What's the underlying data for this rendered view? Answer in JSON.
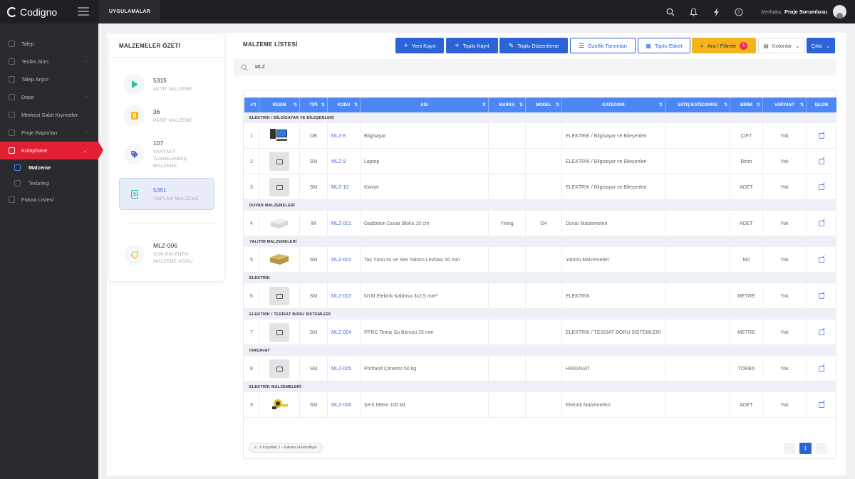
{
  "app": {
    "brand": "Codigno",
    "top_menu": "UYGULAMALAR",
    "greeting": "Merhaba,",
    "user": "Proje Sorumlusu"
  },
  "sidebar": {
    "items": [
      {
        "label": "Talep",
        "has_chevron": false
      },
      {
        "label": "Teslim Alım",
        "has_chevron": true
      },
      {
        "label": "Talep Arşivi",
        "has_chevron": false
      },
      {
        "label": "Depo",
        "has_chevron": true
      },
      {
        "label": "Merkezi Sabit Kıymetler",
        "has_chevron": false
      },
      {
        "label": "Proje Raporları",
        "has_chevron": true
      },
      {
        "label": "Kütüphane",
        "has_chevron": true,
        "active": true
      }
    ],
    "sub_items": [
      {
        "label": "Malzeme",
        "active": true
      },
      {
        "label": "Tedarikçi"
      }
    ],
    "extra": [
      {
        "label": "Fatura Listesi"
      }
    ]
  },
  "summary": {
    "title": "MALZEMELER ÖZETİ",
    "items": [
      {
        "value": "5315",
        "label": "AKTİF MALZEME",
        "icon": "play-icon",
        "color": "#2fc1a7"
      },
      {
        "value": "36",
        "label": "PASİF MALZEME",
        "icon": "pause-icon",
        "color": "#f5b31c"
      },
      {
        "value": "107",
        "label": "VARYANT TANIMLANMIŞ MALZEME",
        "icon": "tag-icon",
        "color": "#5a6fd8"
      },
      {
        "value": "5351",
        "label": "TOPLAM MALZEME",
        "icon": "document-icon",
        "color": "#2fc1a7"
      },
      {
        "value": "MLZ-006",
        "label": "SON EKLENEN MALZEME KODU",
        "icon": "label-icon",
        "color": "#f5b31c"
      }
    ]
  },
  "list": {
    "title": "MALZEME LİSTESİ",
    "buttons": {
      "new": "Yeni Kayıt",
      "bulk": "Toplu Kayıt",
      "bulk_edit": "Toplu Düzenleme",
      "props": "Özellik Tanımları",
      "bulk_label": "Toplu Etiket",
      "filter": "Ara / Filtrele",
      "filter_count": "1",
      "columns": "Kolonlar",
      "output": "Çıktı"
    },
    "search_value": "MLZ",
    "columns": [
      "#",
      "RESİM",
      "TİPİ",
      "KODU",
      "ADI",
      "MARKA",
      "MODEL",
      "KATEGORİ",
      "SATIŞ KATEGORİSİ",
      "BİRİM",
      "VARYANT",
      "İŞLEM"
    ],
    "groups": [
      "ELEKTRİK / BİLGİSAYAR VE BİLEŞENLERİ",
      "DUVAR MALZEMELERİ",
      "YALITIM MALZEMELERİ",
      "ELEKTRİK",
      "ELEKTRİK / TESİSAT BORU SİSTEMLERİ",
      "HIRDAVAT",
      "ELEKTRİK MALZEMELERİ"
    ],
    "rows": [
      {
        "no": "1",
        "type": "DB",
        "code": "MLZ-8",
        "name": "Bilgisayar",
        "brand": "",
        "model": "",
        "category": "ELEKTRİK / Bilgisayar ve Bileşenleri",
        "unit": "ÇİFT",
        "variant": "Yok",
        "image": "computer"
      },
      {
        "no": "2",
        "type": "SM",
        "code": "MLZ-9",
        "name": "Laptop",
        "brand": "",
        "model": "",
        "category": "ELEKTRİK / Bilgisayar ve Bileşenleri",
        "unit": "Birim",
        "variant": "Yok",
        "image": "placeholder"
      },
      {
        "no": "3",
        "type": "SM",
        "code": "MLZ-10",
        "name": "Klavye",
        "brand": "",
        "model": "",
        "category": "ELEKTRİK / Bilgisayar ve Bileşenleri",
        "unit": "ADET",
        "variant": "Yok",
        "image": "placeholder"
      },
      {
        "no": "4",
        "type": "IM",
        "code": "MLZ-001",
        "name": "Gazbeton Duvar Bloku 10 cm",
        "brand": "Ytong",
        "model": "G4",
        "category": "Duvar Malzemeleri",
        "unit": "ADET",
        "variant": "Yok",
        "image": "block"
      },
      {
        "no": "5",
        "type": "SM",
        "code": "MLZ-002",
        "name": "Taş Yünü Isı ve Ses Yalıtım Levhası 50 mm",
        "brand": "",
        "model": "",
        "category": "Yalıtım Malzemeleri",
        "unit": "M2",
        "variant": "Yok",
        "image": "insulation"
      },
      {
        "no": "6",
        "type": "SM",
        "code": "MLZ-003",
        "name": "NYM Elektrik Kablosu 3x2,5 mm²",
        "brand": "",
        "model": "",
        "category": "ELEKTRİK",
        "unit": "METRE",
        "variant": "Yok",
        "image": "placeholder"
      },
      {
        "no": "7",
        "type": "SM",
        "code": "MLZ-004",
        "name": "PPRC Temiz Su Borusu 25 mm",
        "brand": "",
        "model": "",
        "category": "ELEKTRİK / TESİSAT BORU SİSTEMLERİ",
        "unit": "METRE",
        "variant": "Yok",
        "image": "placeholder"
      },
      {
        "no": "8",
        "type": "SM",
        "code": "MLZ-005",
        "name": "Portland Çimento 50 kg",
        "brand": "",
        "model": "",
        "category": "HIRDAVAT",
        "unit": "TORBA",
        "variant": "Yok",
        "image": "placeholder"
      },
      {
        "no": "9",
        "type": "SM",
        "code": "MLZ-006",
        "name": "Şerit Metre 100 Mt.",
        "brand": "",
        "model": "",
        "category": "Elektrik Malzemeleri",
        "unit": "ADET",
        "variant": "Yok",
        "image": "tape"
      }
    ],
    "footer_info": "9 Kayıttan 1 - 9 Arası Gösteriliyor",
    "pagination": {
      "prev": "‹",
      "current": "1",
      "next": "›"
    }
  }
}
